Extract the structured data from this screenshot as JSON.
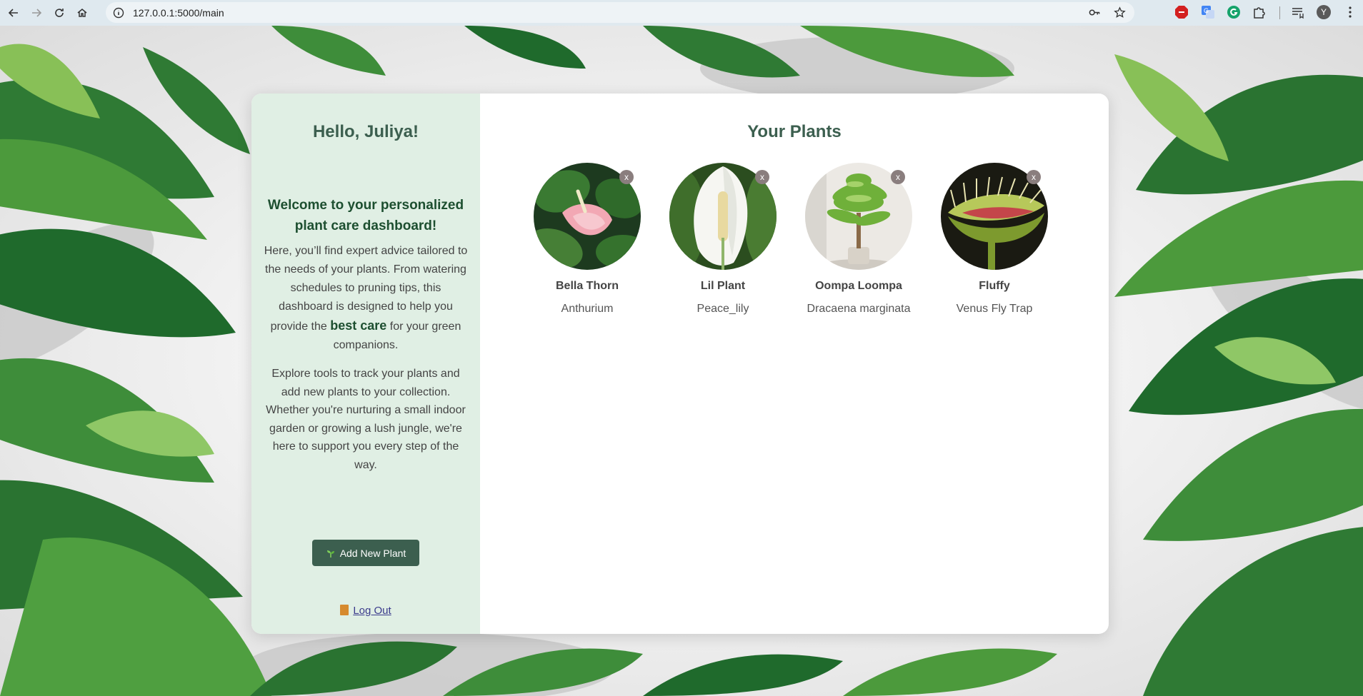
{
  "browser": {
    "url": "127.0.0.1:5000/main",
    "profile_initial": "Y"
  },
  "sidebar": {
    "greeting": "Hello, Juliya!",
    "welcome": "Welcome to your personalized plant care dashboard!",
    "intro_before": "Here, you’ll find expert advice tailored to the needs of your plants. From watering schedules to pruning tips, this dashboard is designed to help you provide the ",
    "intro_bold": "best care",
    "intro_after": " for your green companions.",
    "explore": "Explore tools to track your plants and add new plants to your collection. Whether you're nurturing a small indoor garden or growing a lush jungle, we're here to support you every step of the way.",
    "add_button": "Add New Plant",
    "logout": "Log Out"
  },
  "main": {
    "title": "Your Plants",
    "remove_label": "x",
    "plants": [
      {
        "name": "Bella Thorn",
        "species": "Anthurium"
      },
      {
        "name": "Lil Plant",
        "species": "Peace_lily"
      },
      {
        "name": "Oompa Loompa",
        "species": "Dracaena marginata"
      },
      {
        "name": "Fluffy",
        "species": "Venus Fly Trap"
      }
    ]
  },
  "icons": {
    "back": "arrow-left-icon",
    "forward": "arrow-right-icon",
    "reload": "reload-icon",
    "home": "home-icon",
    "info": "info-icon",
    "key": "key-icon",
    "star": "star-icon",
    "sprout": "sprout-icon",
    "door": "door-icon"
  },
  "colors": {
    "accent": "#3c5f4f",
    "sidebar_bg": "#e0efe4",
    "heading_green": "#1d4f30"
  }
}
